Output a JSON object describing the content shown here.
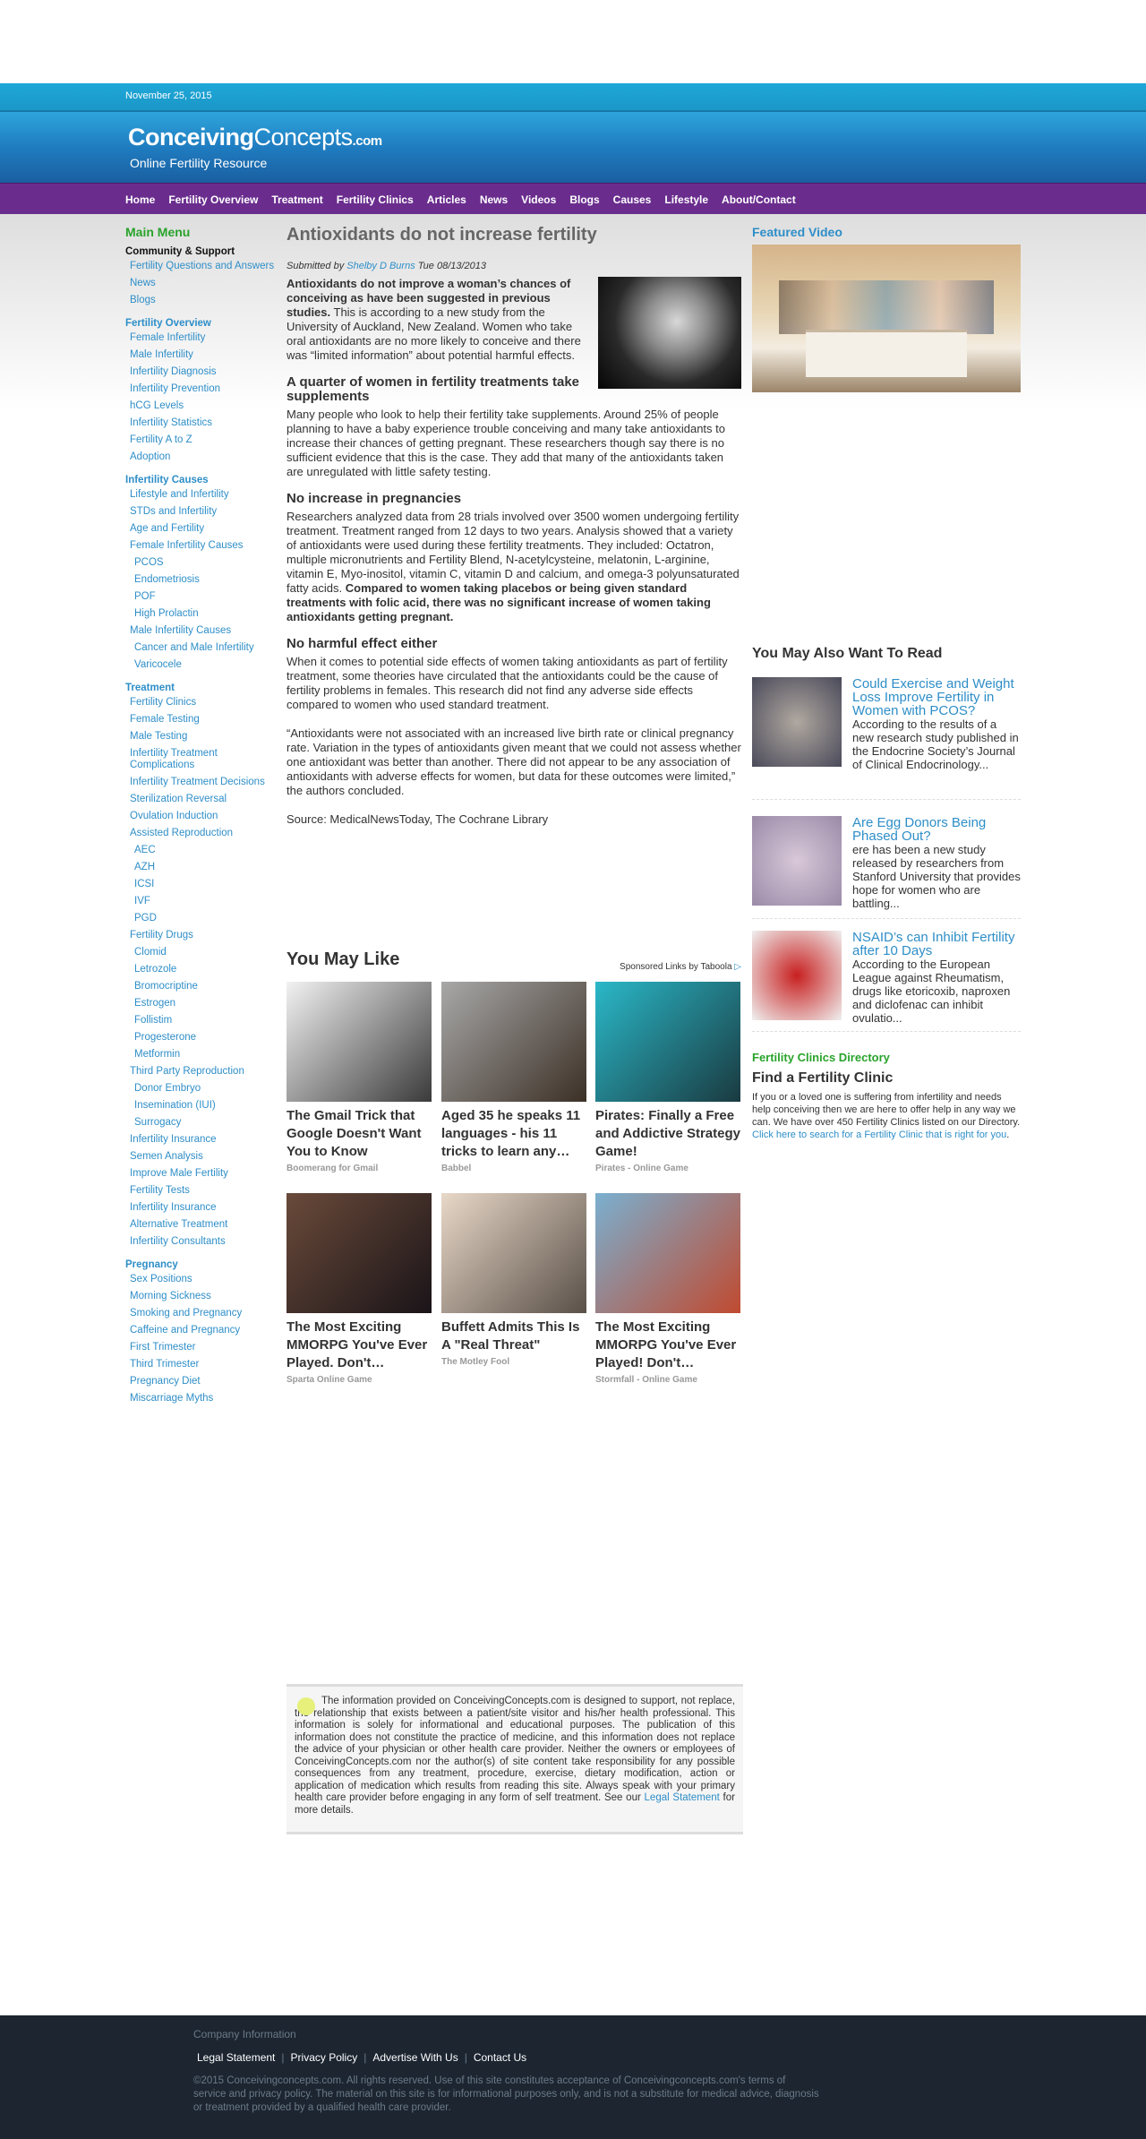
{
  "date": "November 25, 2015",
  "logo": {
    "line1a": "Conceiving",
    "line1b": "Concepts",
    "line1c": ".com",
    "line2": "Online Fertility Resource"
  },
  "nav": [
    "Home",
    "Fertility Overview",
    "Treatment",
    "Fertility Clinics",
    "Articles",
    "News",
    "Videos",
    "Blogs",
    "Causes",
    "Lifestyle",
    "About/Contact"
  ],
  "sidebar": {
    "title": "Main Menu",
    "sections": [
      {
        "title": "Community & Support",
        "black": true,
        "items": [
          {
            "label": "Fertility Questions and Answers",
            "indent": 0
          },
          {
            "label": "News",
            "indent": 0
          },
          {
            "label": "Blogs",
            "indent": 0
          }
        ]
      },
      {
        "title": "Fertility Overview",
        "items": [
          {
            "label": "Female Infertility",
            "indent": 0
          },
          {
            "label": "Male Infertility",
            "indent": 0
          },
          {
            "label": "Infertility Diagnosis",
            "indent": 0
          },
          {
            "label": "Infertility Prevention",
            "indent": 0
          },
          {
            "label": "hCG Levels",
            "indent": 0
          },
          {
            "label": "Infertility Statistics",
            "indent": 0
          },
          {
            "label": "Fertility A to Z",
            "indent": 0
          },
          {
            "label": "Adoption",
            "indent": 0
          }
        ]
      },
      {
        "title": "Infertility Causes",
        "items": [
          {
            "label": "Lifestyle and Infertility",
            "indent": 0
          },
          {
            "label": "STDs and Infertility",
            "indent": 0
          },
          {
            "label": "Age and Fertility",
            "indent": 0
          },
          {
            "label": "Female Infertility Causes",
            "indent": 0
          },
          {
            "label": "PCOS",
            "indent": 1
          },
          {
            "label": "Endometriosis",
            "indent": 1
          },
          {
            "label": "POF",
            "indent": 1
          },
          {
            "label": "High Prolactin",
            "indent": 1
          },
          {
            "label": "Male Infertility Causes",
            "indent": 0
          },
          {
            "label": "Cancer and Male Infertility",
            "indent": 1
          },
          {
            "label": "Varicocele",
            "indent": 1
          }
        ]
      },
      {
        "title": "Treatment",
        "items": [
          {
            "label": "Fertility Clinics",
            "indent": 0
          },
          {
            "label": "Female Testing",
            "indent": 0
          },
          {
            "label": "Male Testing",
            "indent": 0
          },
          {
            "label": "Infertility Treatment Complications",
            "indent": 0
          },
          {
            "label": "Infertility Treatment Decisions",
            "indent": 0
          },
          {
            "label": "Sterilization Reversal",
            "indent": 0
          },
          {
            "label": "Ovulation Induction",
            "indent": 0
          },
          {
            "label": "Assisted Reproduction",
            "indent": 0
          },
          {
            "label": "AEC",
            "indent": 1
          },
          {
            "label": "AZH",
            "indent": 1
          },
          {
            "label": "ICSI",
            "indent": 1
          },
          {
            "label": "IVF",
            "indent": 1
          },
          {
            "label": "PGD",
            "indent": 1
          },
          {
            "label": "Fertility Drugs",
            "indent": 0
          },
          {
            "label": "Clomid",
            "indent": 1
          },
          {
            "label": "Letrozole",
            "indent": 1
          },
          {
            "label": "Bromocriptine",
            "indent": 1
          },
          {
            "label": "Estrogen",
            "indent": 1
          },
          {
            "label": "Follistim",
            "indent": 1
          },
          {
            "label": "Progesterone",
            "indent": 1
          },
          {
            "label": "Metformin",
            "indent": 1
          },
          {
            "label": "Third Party Reproduction",
            "indent": 0
          },
          {
            "label": "Donor Embryo",
            "indent": 1
          },
          {
            "label": "Insemination (IUI)",
            "indent": 1
          },
          {
            "label": "Surrogacy",
            "indent": 1
          },
          {
            "label": "Infertility Insurance",
            "indent": 0
          },
          {
            "label": "Semen Analysis",
            "indent": 0
          },
          {
            "label": "Improve Male Fertility",
            "indent": 0
          },
          {
            "label": "Fertility Tests",
            "indent": 0
          },
          {
            "label": "Infertility Insurance",
            "indent": 0
          },
          {
            "label": "Alternative Treatment",
            "indent": 0
          },
          {
            "label": "Infertility Consultants",
            "indent": 0
          }
        ]
      },
      {
        "title": "Pregnancy",
        "items": [
          {
            "label": "Sex Positions",
            "indent": 0
          },
          {
            "label": "Morning Sickness",
            "indent": 0
          },
          {
            "label": "Smoking and Pregnancy",
            "indent": 0
          },
          {
            "label": "Caffeine and Pregnancy",
            "indent": 0
          },
          {
            "label": "First Trimester",
            "indent": 0
          },
          {
            "label": "Third Trimester",
            "indent": 0
          },
          {
            "label": "Pregnancy Diet",
            "indent": 0
          },
          {
            "label": "Miscarriage Myths",
            "indent": 0
          }
        ]
      }
    ]
  },
  "article": {
    "title": "Antioxidants do not increase fertility",
    "submitted_prefix": "Submitted by",
    "author": "Shelby D Burns",
    "date": "Tue 08/13/2013",
    "intro_bold": "Antioxidants do not improve a woman’s chances of conceiving as have been suggested in previous studies.",
    "intro_rest": " This is according to a new study from the University of Auckland, New Zealand. Women who take oral antioxidants are no more likely to conceive and there was “limited information” about potential harmful effects.",
    "h2_1": "A quarter of women in fertility treatments take supplements",
    "p1": "Many people who look to help their fertility take supplements. Around 25% of people planning to have a baby experience trouble conceiving and many take antioxidants to increase their chances of getting pregnant. These researchers though say there is no sufficient evidence that this is the case. They add that many of the antioxidants taken are unregulated with little safety testing.",
    "h2_2": "No increase in pregnancies",
    "p2": "Researchers analyzed data from 28 trials involved over 3500 women undergoing fertility treatment. Treatment ranged from 12 days to two years. Analysis showed that a variety of antioxidants were used during these fertility treatments. They included: Octatron, multiple micronutrients and Fertility Blend, N-acetylcysteine, melatonin, L-arginine, vitamin E, Myo-inositol, vitamin C, vitamin D and calcium, and omega-3 polyunsaturated fatty acids. ",
    "p2_bold": "Compared to women taking placebos or being given standard treatments with folic acid, there was no significant increase of women taking antioxidants getting pregnant.",
    "h2_3": "No harmful effect either",
    "p3": "When it comes to potential side effects of women taking antioxidants as part of fertility treatment, some theories have circulated that the antioxidants could be the cause of fertility problems in females. This research did not find any adverse side effects compared to women who used standard treatment.",
    "p4": "“Antioxidants were not associated with an increased live birth rate or clinical pregnancy rate. Variation in the types of antioxidants given meant that we could not assess whether one antioxidant was better than another. There did not appear to be any association of antioxidants with adverse effects for women, but data for these outcomes were limited,” the authors concluded.",
    "source": "Source: MedicalNewsToday, The Cochrane Library"
  },
  "you_may_like": {
    "title": "You May Like",
    "sponsored": "Sponsored Links by Taboola",
    "cards": [
      {
        "title": "The Gmail Trick that Google Doesn't Want You to Know",
        "source": "Boomerang for Gmail",
        "color1": "#f2f2f2",
        "color2": "#3a3a3a"
      },
      {
        "title": "Aged 35 he speaks 11 languages - his 11 tricks to learn any…",
        "source": "Babbel",
        "color1": "#a8a8a8",
        "color2": "#3c3026"
      },
      {
        "title": "Pirates: Finally a Free and Addictive Strategy Game!",
        "source": "Pirates - Online Game",
        "color1": "#2ab8c8",
        "color2": "#1a3a40"
      },
      {
        "title": "The Most Exciting MMORPG You've Ever Played. Don't…",
        "source": "Sparta Online Game",
        "color1": "#6a4a3a",
        "color2": "#1a1418"
      },
      {
        "title": "Buffett Admits This Is A \"Real Threat\"",
        "source": "The Motley Fool",
        "color1": "#e8d8c8",
        "color2": "#5a5048"
      },
      {
        "title": "The Most Exciting MMORPG You've Ever Played! Don't…",
        "source": "Stormfall - Online Game",
        "color1": "#7ab0d0",
        "color2": "#c04a30"
      }
    ]
  },
  "right": {
    "featured_video": "Featured Video",
    "also_read_title": "You May Also Want To Read",
    "related": [
      {
        "title": "Could Exercise and Weight Loss Improve Fertility in Women with PCOS?",
        "desc": "According to the results of a new research study published in the Endocrine Society’s Journal of Clinical Endocrinology...",
        "color1": "#b0a8a0",
        "color2": "#4a4a5a"
      },
      {
        "title": "Are Egg Donors Being Phased Out?",
        "desc": "ere has been a new study released by researchers from Stanford University that provides hope for women who are battling...",
        "color1": "#d8c8d8",
        "color2": "#9a8aa8"
      },
      {
        "title": "NSAID’s can Inhibit Fertility after 10 Days",
        "desc": "According to the European League against Rheumatism, drugs like etoricoxib, naproxen and diclofenac can inhibit ovulatio...",
        "color1": "#c82020",
        "color2": "#f0f0f0"
      }
    ],
    "fcd_title": "Fertility Clinics Directory",
    "fcd_sub": "Find a Fertility Clinic",
    "fcd_text": "If you or a loved one is suffering from infertility and needs help conceiving then we are here to offer help in any way we can. We have over 450 Fertility Clinics listed on our Directory. ",
    "fcd_link": "Click here to search for a Fertility Clinic that is right for you",
    "fcd_end": "."
  },
  "disclaimer": {
    "text": "The information provided on ConceivingConcepts.com is designed to support, not replace, the relationship that exists between a patient/site visitor and his/her health professional. This information is solely for informational and educational purposes. The publication of this information does not constitute the practice of medicine, and this information does not replace the advice of your physician or other health care provider. Neither the owners or employees of ConceivingConcepts.com nor the author(s) of site content take responsibility for any possible consequences from any treatment, procedure, exercise, dietary modification, action or application of medication which results from reading this site. Always speak with your primary health care provider before engaging in any form of self treatment. See our ",
    "link": "Legal Statement",
    "end": " for more details."
  },
  "footer": {
    "company": "Company Information",
    "links": [
      "Legal Statement",
      "Privacy Policy",
      "Advertise With Us",
      "Contact Us"
    ],
    "copy": "©2015 Conceivingconcepts.com. All rights reserved. Use of this site constitutes acceptance of Conceivingconcepts.com's terms of service and privacy policy. The material on this site is for informational purposes only, and is not a substitute for medical advice, diagnosis or treatment provided by a qualified health care provider."
  }
}
